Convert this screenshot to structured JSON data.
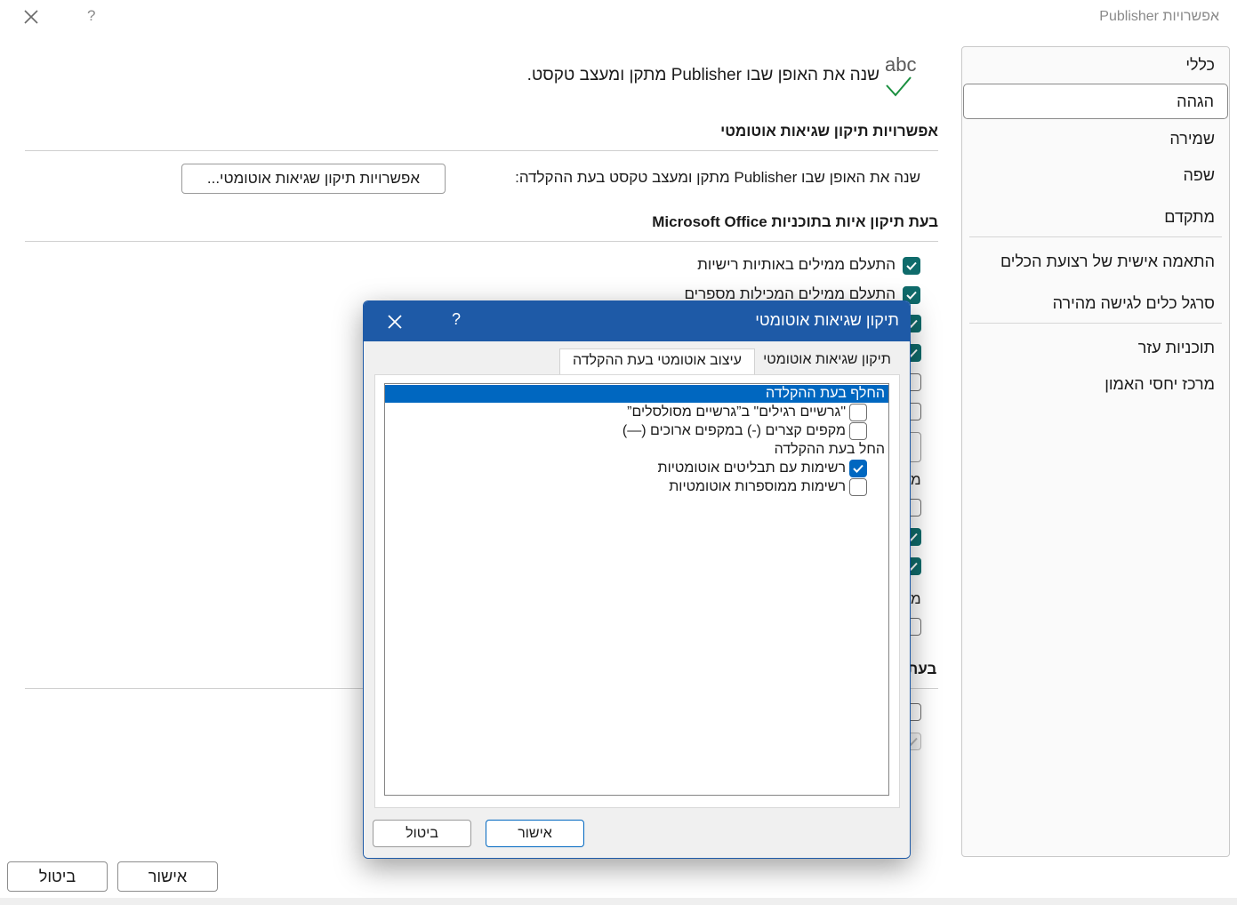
{
  "window": {
    "title": "אפשרויות Publisher",
    "help_label": "?"
  },
  "sidebar": {
    "items": [
      {
        "label": "כללי"
      },
      {
        "label": "הגהה",
        "selected": true
      },
      {
        "label": "שמירה"
      },
      {
        "label": "שפה"
      },
      {
        "label": "מתקדם"
      },
      {
        "label": "התאמה אישית של רצועת הכלים"
      },
      {
        "label": "סרגל כלים לגישה מהירה"
      },
      {
        "label": "תוכניות עזר"
      },
      {
        "label": "מרכז יחסי האמון"
      }
    ]
  },
  "main": {
    "intro": "שנה את האופן שבו Publisher מתקן ומעצב טקסט.",
    "icon_label": "abc",
    "autocorrect_section": {
      "heading": "אפשרויות תיקון שגיאות אוטומטי",
      "description": "שנה את האופן שבו Publisher מתקן ומעצב טקסט בעת ההקלדה:",
      "button_label": "אפשרויות תיקון שגיאות אוטומטי..."
    },
    "spelling_section": {
      "heading": "בעת תיקון איות בתוכניות Microsoft Office",
      "options": [
        {
          "label": "התעלם ממילים באותיות רישיות",
          "checked": true
        },
        {
          "label": "התעלם ממילים המכילות מספרים",
          "checked": true
        }
      ]
    },
    "partial_letter_1": "מ",
    "partial_letter_2": "מ",
    "partial_heading": "בעת"
  },
  "main_buttons": {
    "ok": "אישור",
    "cancel": "ביטול"
  },
  "dialog": {
    "title": "תיקון שגיאות אוטומטי",
    "help_label": "?",
    "tabs": [
      {
        "label": "תיקון שגיאות אוטומטי"
      },
      {
        "label": "עיצוב אוטומטי בעת ההקלדה",
        "active": true
      }
    ],
    "list": {
      "group1_heading": "החלף בעת ההקלדה",
      "group1_items": [
        {
          "label": "\"גרשיים רגילים\" ב”גרשיים מסולסלים”",
          "checked": false
        },
        {
          "label": "מקפים קצרים (-) במקפים ארוכים (—)",
          "checked": false
        }
      ],
      "group2_heading": "החל בעת ההקלדה",
      "group2_items": [
        {
          "label": "רשימות עם תבליטים אוטומטיות",
          "checked": true
        },
        {
          "label": "רשימות ממוספרות אוטומטיות",
          "checked": false
        }
      ]
    },
    "buttons": {
      "ok": "אישור",
      "cancel": "ביטול"
    }
  }
}
